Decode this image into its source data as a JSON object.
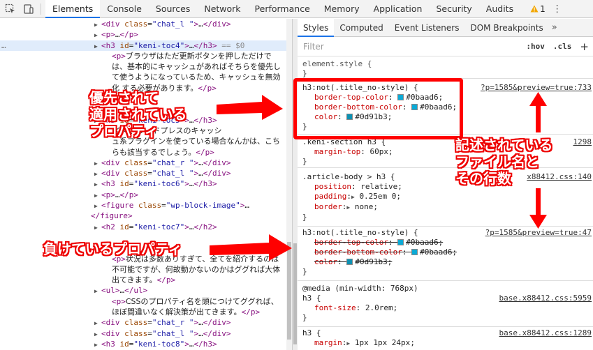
{
  "toolbar": {
    "tabs": [
      "Elements",
      "Console",
      "Sources",
      "Network",
      "Performance",
      "Memory",
      "Application",
      "Security",
      "Audits"
    ],
    "warning_count": "1"
  },
  "dom_lines": [
    {
      "indent": 9,
      "tri": "▶",
      "html": "<span class=\"tag\">&lt;div</span> <span class=\"attr\">class</span>=<span class=\"val\">\"chat_l \"</span><span class=\"tag\">&gt;</span>…<span class=\"tag\">&lt;/div&gt;</span>"
    },
    {
      "indent": 9,
      "tri": "▶",
      "html": "<span class=\"tag\">&lt;p&gt;</span>…<span class=\"tag\">&lt;/p&gt;</span>"
    },
    {
      "indent": 9,
      "tri": "▶",
      "sel": true,
      "dots": "…",
      "html": "<span class=\"tag\">&lt;h3</span> <span class=\"attr\">id</span>=<span class=\"val\">\"keni-toc4\"</span><span class=\"tag\">&gt;</span>…<span class=\"tag\">&lt;/h3&gt;</span> <span class=\"eq0\">== $0</span>"
    },
    {
      "indent": 10,
      "tri": "",
      "html": "<span class=\"tag\">&lt;p&gt;</span><span class=\"txt\">ブラウザはただ更新ボタンを押しただけで</span>"
    },
    {
      "indent": 10,
      "tri": "",
      "html": "<span class=\"txt\">は、基本的にキャッシュがあればそちらを優先し</span>"
    },
    {
      "indent": 10,
      "tri": "",
      "html": "<span class=\"txt\">て使うようになっているため、キャッシュを無効</span>"
    },
    {
      "indent": 10,
      "tri": "",
      "html": "<span class=\"txt\">化  する必要があります。</span><span class=\"tag\">&lt;/p&gt;</span>"
    },
    {
      "indent": 9,
      "tri": "",
      "html": ""
    },
    {
      "indent": 9,
      "tri": "",
      "html": ""
    },
    {
      "indent": 9,
      "tri": "▶",
      "html": "<span class=\"tag\">&lt;h3</span> <span class=\"attr\">id</span>=<span class=\"val\">\"keni-toc5\"</span><span class=\"tag\">&gt;</span>…<span class=\"tag\">&lt;/h3&gt;</span>"
    },
    {
      "indent": 10,
      "tri": "",
      "html": "<span class=\"txt\">                くく、ワードプレスのキャッシ</span>"
    },
    {
      "indent": 10,
      "tri": "",
      "html": "<span class=\"txt\">ュ系プラグインを使っている場合なんかは、こち</span>"
    },
    {
      "indent": 10,
      "tri": "",
      "html": "<span class=\"txt\">らも該当するでしょう。</span><span class=\"tag\">&lt;/p&gt;</span>"
    },
    {
      "indent": 9,
      "tri": "▶",
      "html": "<span class=\"tag\">&lt;div</span> <span class=\"attr\">class</span>=<span class=\"val\">\"chat_r \"</span><span class=\"tag\">&gt;</span>…<span class=\"tag\">&lt;/div&gt;</span>"
    },
    {
      "indent": 9,
      "tri": "▶",
      "html": "<span class=\"tag\">&lt;div</span> <span class=\"attr\">class</span>=<span class=\"val\">\"chat_l \"</span><span class=\"tag\">&gt;</span>…<span class=\"tag\">&lt;/div&gt;</span>"
    },
    {
      "indent": 9,
      "tri": "▶",
      "html": "<span class=\"tag\">&lt;h3</span> <span class=\"attr\">id</span>=<span class=\"val\">\"keni-toc6\"</span><span class=\"tag\">&gt;</span>…<span class=\"tag\">&lt;/h3&gt;</span>"
    },
    {
      "indent": 9,
      "tri": "▶",
      "html": "<span class=\"tag\">&lt;p&gt;</span>…<span class=\"tag\">&lt;/p&gt;</span>"
    },
    {
      "indent": 9,
      "tri": "▶",
      "html": "<span class=\"tag\">&lt;figure</span> <span class=\"attr\">class</span>=<span class=\"val\">\"wp-block-image\"</span><span class=\"tag\">&gt;</span>…"
    },
    {
      "indent": 8,
      "tri": "",
      "html": "<span class=\"tag\">&lt;/figure&gt;</span>"
    },
    {
      "indent": 9,
      "tri": "▶",
      "html": "<span class=\"tag\">&lt;h2</span> <span class=\"attr\">id</span>=<span class=\"val\">\"keni-toc7\"</span><span class=\"tag\">&gt;</span>…<span class=\"tag\">&lt;/h2&gt;</span>"
    },
    {
      "indent": 9,
      "tri": "",
      "html": ""
    },
    {
      "indent": 9,
      "tri": "",
      "html": ""
    },
    {
      "indent": 10,
      "tri": "",
      "html": "<span class=\"tag\">&lt;p&gt;</span><span class=\"txt\">状況は多数ありすぎて、全てを紹介するのは</span>"
    },
    {
      "indent": 10,
      "tri": "",
      "html": "<span class=\"txt\">不可能ですが、何故動かないのかはググれば大体</span>"
    },
    {
      "indent": 10,
      "tri": "",
      "html": "<span class=\"txt\">出てきます。</span><span class=\"tag\">&lt;/p&gt;</span>"
    },
    {
      "indent": 9,
      "tri": "▶",
      "html": "<span class=\"tag\">&lt;ul&gt;</span>…<span class=\"tag\">&lt;/ul&gt;</span>"
    },
    {
      "indent": 10,
      "tri": "",
      "html": "<span class=\"tag\">&lt;p&gt;</span><span class=\"txt\">CSSのプロパティ名を頭につけてググれば、</span>"
    },
    {
      "indent": 10,
      "tri": "",
      "html": "<span class=\"txt\">ほぼ間違いなく解決策が出てきます。</span><span class=\"tag\">&lt;/p&gt;</span>"
    },
    {
      "indent": 9,
      "tri": "▶",
      "html": "<span class=\"tag\">&lt;div</span> <span class=\"attr\">class</span>=<span class=\"val\">\"chat_r \"</span><span class=\"tag\">&gt;</span>…<span class=\"tag\">&lt;/div&gt;</span>"
    },
    {
      "indent": 9,
      "tri": "▶",
      "html": "<span class=\"tag\">&lt;div</span> <span class=\"attr\">class</span>=<span class=\"val\">\"chat_l \"</span><span class=\"tag\">&gt;</span>…<span class=\"tag\">&lt;/div&gt;</span>"
    },
    {
      "indent": 9,
      "tri": "▶",
      "html": "<span class=\"tag\">&lt;h3</span> <span class=\"attr\">id</span>=<span class=\"val\">\"keni-toc8\"</span><span class=\"tag\">&gt;</span>…<span class=\"tag\">&lt;/h3&gt;</span>"
    }
  ],
  "styles_tabs": [
    "Styles",
    "Computed",
    "Event Listeners",
    "DOM Breakpoints"
  ],
  "filter": {
    "placeholder": "Filter",
    "hov": ":hov",
    "cls": ".cls",
    "plus": "+"
  },
  "rules": {
    "element_style": {
      "selector": "element.style {",
      "close": "}"
    },
    "r1": {
      "selector": "h3:not(.title_no-style) {",
      "source": "?p=1585&preview=true:733",
      "props": [
        {
          "name": "border-top-color",
          "value": "#0baad6",
          "color": "#0baad6"
        },
        {
          "name": "border-bottom-color",
          "value": "#0baad6",
          "color": "#0baad6"
        },
        {
          "name": "color",
          "value": "#0d91b3",
          "color": "#0d91b3"
        }
      ],
      "close": "}"
    },
    "r2": {
      "selector": ".keni-section h3 {",
      "source": "1298",
      "props": [
        {
          "name": "margin-top",
          "value": "60px"
        }
      ],
      "close": "}"
    },
    "r3": {
      "selector": ".article-body > h3 {",
      "source": "x88412.css:140",
      "props": [
        {
          "name": "position",
          "value": "relative"
        },
        {
          "name": "padding",
          "value": "0.25em 0"
        },
        {
          "name": "border",
          "value": "none"
        }
      ],
      "close": "}"
    },
    "r4": {
      "selector": "h3:not(.title_no-style) {",
      "source": "?p=1585&preview=true:47",
      "props": [
        {
          "name": "border-top-color",
          "value": "#0baad6",
          "color": "#0baad6"
        },
        {
          "name": "border-bottom-color",
          "value": "#0baad6",
          "color": "#0baad6"
        },
        {
          "name": "color",
          "value": "#0d91b3",
          "color": "#0d91b3"
        }
      ],
      "close": "}"
    },
    "r5": {
      "media": "@media (min-width: 768px)",
      "selector": "h3 {",
      "source": "base.x88412.css:5959",
      "props": [
        {
          "name": "font-size",
          "value": "2.0rem"
        }
      ],
      "close": "}"
    },
    "r6": {
      "selector": "h3 {",
      "source": "base.x88412.css:1289",
      "props": [
        {
          "name": "margin",
          "value": "1px 1px 24px"
        }
      ]
    }
  },
  "annotations": {
    "applied": [
      "優先されて",
      "適用されている",
      "プロパティ"
    ],
    "source": [
      "記述されている",
      "ファイル名と",
      "その行数"
    ],
    "overridden": "負けているプロパティ"
  },
  "colors": {
    "accent": "#1a73e8",
    "annotation_red": "#ee0000"
  }
}
